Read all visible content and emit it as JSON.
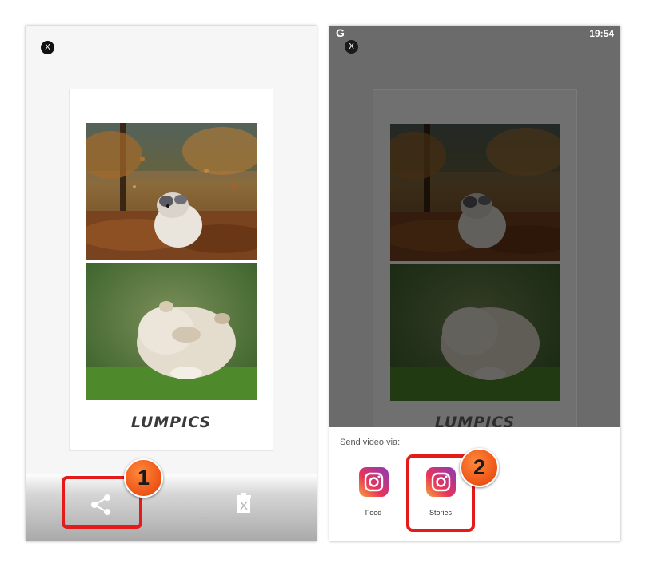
{
  "left_screen": {
    "close_label": "X",
    "brand_text": "LUMPICS",
    "step_number": "1"
  },
  "right_screen": {
    "status_bar": {
      "logo": "G",
      "time": "19:54"
    },
    "close_label": "X",
    "brand_text": "LUMPICS",
    "sheet": {
      "title": "Send video via:",
      "targets": [
        {
          "label": "Feed",
          "icon": "instagram-icon"
        },
        {
          "label": "Stories",
          "icon": "instagram-icon"
        }
      ]
    },
    "step_number": "2"
  },
  "colors": {
    "highlight": "#e31b1b",
    "badge": "#f05a1a",
    "dim_overlay": "#6b6b6b"
  }
}
